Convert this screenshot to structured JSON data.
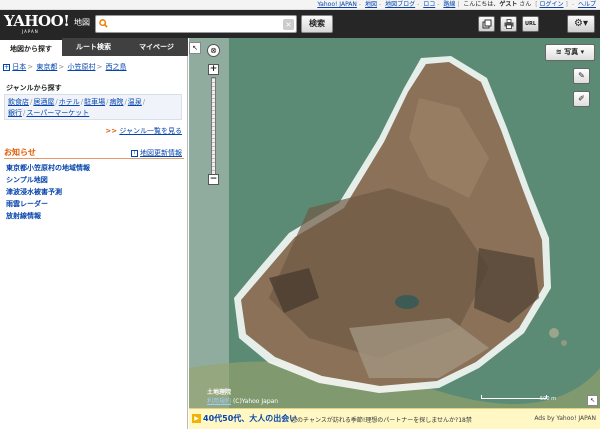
{
  "topbar": {
    "links": [
      "Yahoo! JAPAN",
      "地図",
      "地図ブログ",
      "ロコ",
      "路線"
    ],
    "greeting": "こんにちは、",
    "user": "ゲスト",
    "honorific": "さん",
    "login": "ログイン",
    "help": "ヘルプ"
  },
  "header": {
    "logo": "YAHOO!",
    "logo_sub": "JAPAN",
    "service": "地図",
    "search_placeholder": "",
    "clear_label": "×",
    "search_button": "検索",
    "url_button": "URL",
    "gear_icon": "⚙▾"
  },
  "sidebar": {
    "tabs": [
      {
        "label": "地図から探す",
        "active": true
      },
      {
        "label": "ルート検索",
        "active": false
      },
      {
        "label": "マイページ",
        "active": false
      }
    ],
    "breadcrumb": [
      "日本",
      "東京都",
      "小笠原村",
      "西之島"
    ],
    "genre_title": "ジャンルから探す",
    "genre_row1": [
      "飲食店",
      "居酒屋",
      "ホテル",
      "駐車場",
      "病院",
      "温泉"
    ],
    "genre_row2": [
      "銀行",
      "スーパーマーケット"
    ],
    "genre_more": "ジャンル一覧を見る",
    "notice_title": "お知らせ",
    "update_link": "地図更新情報",
    "notices": [
      "東京都小笠原村の地域情報",
      "シンプル地図",
      "津波浸水被害予測",
      "雨雲レーダー",
      "放射線情報"
    ]
  },
  "map": {
    "view_button": "写真",
    "credit": "土地理院",
    "terms": "利用規約",
    "copyright": "(C)Yahoo Japan",
    "scale_label": "500 m"
  },
  "ad": {
    "title": "40代50代、大人の出会い",
    "text": "恋のチャンスが訪れる季節!理想のパートナーを探しませんか?18禁",
    "by": "Ads by Yahoo! JAPAN"
  },
  "colors": {
    "header": "#262626",
    "accent": "#e05a00",
    "link": "#0645ad",
    "sea": "#5f8d79"
  }
}
